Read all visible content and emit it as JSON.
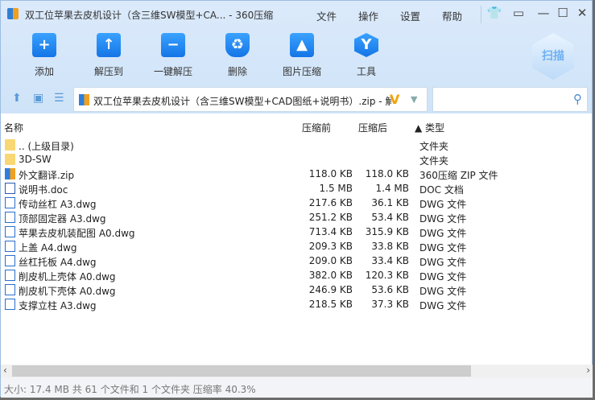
{
  "title": "双工位苹果去皮机设计（含三维SW模型+CA... - 360压缩",
  "menu": [
    "文件",
    "操作",
    "设置",
    "帮助"
  ],
  "toolbar": [
    "添加",
    "解压到",
    "一键解压",
    "删除",
    "图片压缩",
    "工具"
  ],
  "scan": "扫描",
  "address": "双工位苹果去皮机设计（含三维SW模型+CAD图纸+说明书）.zip - 解",
  "headers": {
    "name": "名称",
    "before": "压缩前",
    "after": "压缩后",
    "type": "▲ 类型"
  },
  "files": [
    {
      "name": ".. (上级目录)",
      "before": "",
      "after": "",
      "type": "文件夹",
      "icon": "folder"
    },
    {
      "name": "3D-SW",
      "before": "",
      "after": "",
      "type": "文件夹",
      "icon": "folder"
    },
    {
      "name": "外文翻译.zip",
      "before": "118.0 KB",
      "after": "118.0 KB",
      "type": "360压缩 ZIP 文件",
      "icon": "zip"
    },
    {
      "name": "说明书.doc",
      "before": "1.5 MB",
      "after": "1.4 MB",
      "type": "DOC 文档",
      "icon": "doc"
    },
    {
      "name": "传动丝杠 A3.dwg",
      "before": "217.6 KB",
      "after": "36.1 KB",
      "type": "DWG 文件",
      "icon": "dwg"
    },
    {
      "name": "顶部固定器 A3.dwg",
      "before": "251.2 KB",
      "after": "53.4 KB",
      "type": "DWG 文件",
      "icon": "dwg"
    },
    {
      "name": "苹果去皮机装配图 A0.dwg",
      "before": "713.4 KB",
      "after": "315.9 KB",
      "type": "DWG 文件",
      "icon": "dwg"
    },
    {
      "name": "上盖 A4.dwg",
      "before": "209.3 KB",
      "after": "33.8 KB",
      "type": "DWG 文件",
      "icon": "dwg"
    },
    {
      "name": "丝杠托板 A4.dwg",
      "before": "209.0 KB",
      "after": "33.4 KB",
      "type": "DWG 文件",
      "icon": "dwg"
    },
    {
      "name": "削皮机上壳体 A0.dwg",
      "before": "382.0 KB",
      "after": "120.3 KB",
      "type": "DWG 文件",
      "icon": "dwg"
    },
    {
      "name": "削皮机下壳体 A0.dwg",
      "before": "246.9 KB",
      "after": "53.6 KB",
      "type": "DWG 文件",
      "icon": "dwg"
    },
    {
      "name": "支撑立柱 A3.dwg",
      "before": "218.5 KB",
      "after": "37.3 KB",
      "type": "DWG 文件",
      "icon": "dwg"
    }
  ],
  "status": "大小: 17.4 MB 共 61 个文件和 1 个文件夹 压缩率 40.3%"
}
